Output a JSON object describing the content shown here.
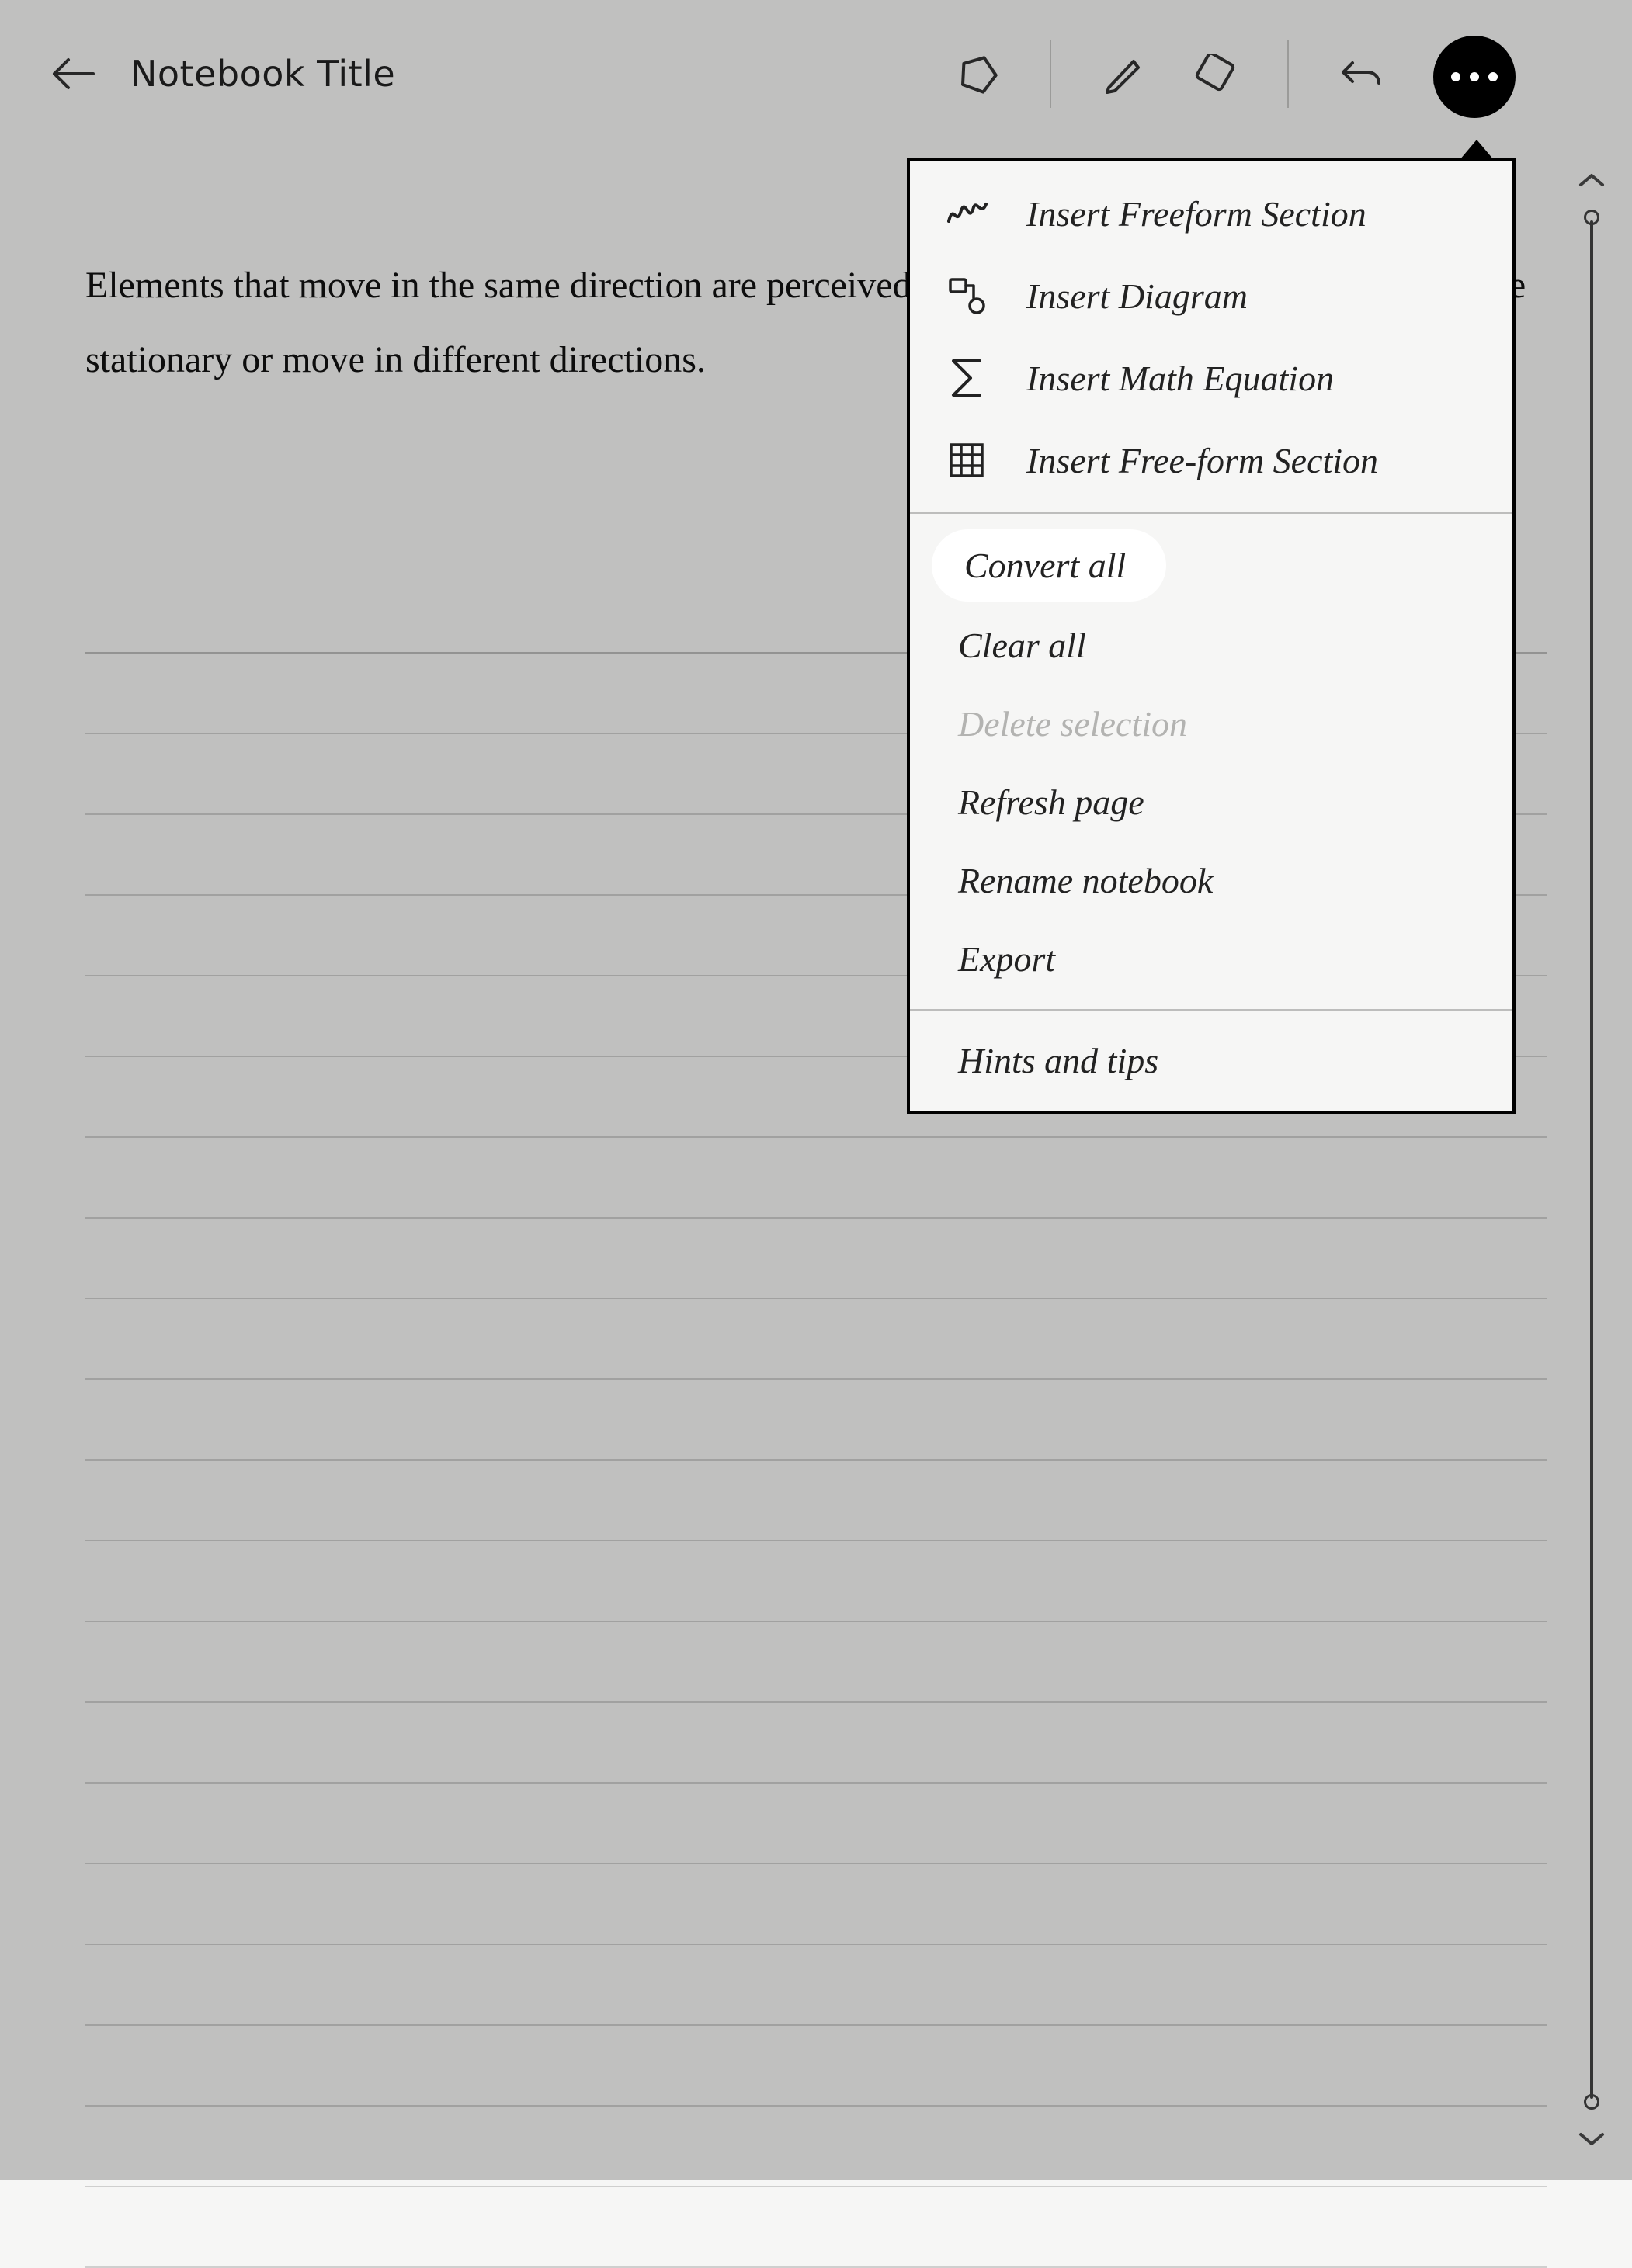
{
  "header": {
    "title": "Notebook Title"
  },
  "body": {
    "text": "Elements that move in the same direction are perceived to be more related than elements that are stationary or move in different directions."
  },
  "menu": {
    "section_insert": [
      {
        "icon": "freeform-icon",
        "label": "Insert Freeform Section"
      },
      {
        "icon": "diagram-icon",
        "label": "Insert Diagram"
      },
      {
        "icon": "math-icon",
        "label": "Insert Math Equation"
      },
      {
        "icon": "grid-icon",
        "label": "Insert Free-form Section"
      }
    ],
    "section_actions": [
      {
        "label": "Convert all",
        "highlight": true
      },
      {
        "label": "Clear all"
      },
      {
        "label": "Delete selection",
        "disabled": true
      },
      {
        "label": "Refresh page"
      },
      {
        "label": "Rename notebook"
      },
      {
        "label": "Export"
      }
    ],
    "section_help": [
      {
        "label": "Hints and tips"
      }
    ]
  }
}
